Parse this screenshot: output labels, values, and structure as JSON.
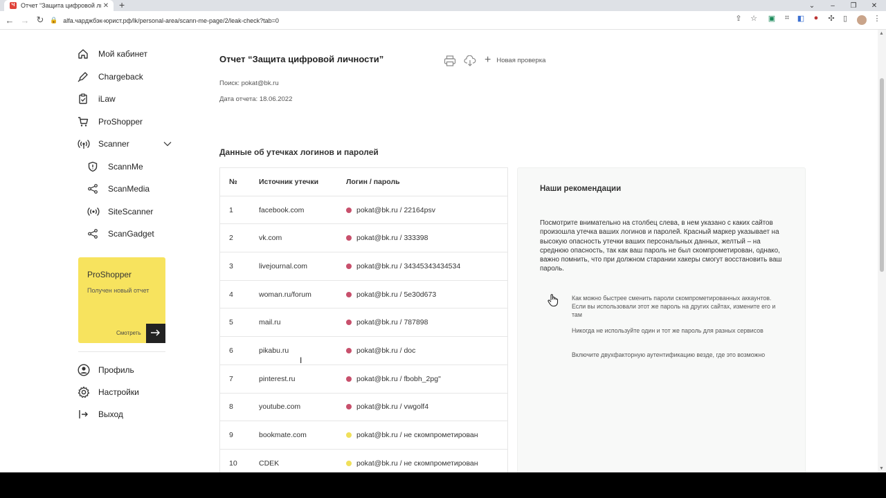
{
  "browser": {
    "tab_title": "Отчет “Защита цифровой личн",
    "tab_favicon": "Ч",
    "new_tab": "+",
    "url": "alfa.чарджбэк-юрист.рф/lk/personal-area/scann-me-page/2/leak-check?tab=0"
  },
  "sidebar": {
    "items": [
      {
        "label": "Мой кабинет",
        "icon": "home-icon"
      },
      {
        "label": "Chargeback",
        "icon": "pen-icon"
      },
      {
        "label": "iLaw",
        "icon": "clipboard-icon"
      },
      {
        "label": "ProShopper",
        "icon": "cart-icon"
      },
      {
        "label": "Scanner",
        "icon": "broadcast-icon"
      }
    ],
    "subitems": [
      {
        "label": "ScannMe",
        "icon": "shield-icon"
      },
      {
        "label": "ScanMedia",
        "icon": "share-icon"
      },
      {
        "label": "SiteScanner",
        "icon": "broadcast-icon"
      },
      {
        "label": "ScanGadget",
        "icon": "share-icon"
      }
    ],
    "promo": {
      "title": "ProShopper",
      "text": "Получен новый отчет",
      "link": "Смотреть"
    },
    "bottom": [
      {
        "label": "Профиль",
        "icon": "user-icon"
      },
      {
        "label": "Настройки",
        "icon": "gear-icon"
      },
      {
        "label": "Выход",
        "icon": "logout-icon"
      }
    ]
  },
  "report": {
    "title": "Отчет “Защита цифровой личности”",
    "new_check": "Новая проверка",
    "search": "Поиск: pokat@bk.ru",
    "date": "Дата отчета: 18.06.2022",
    "section_title": "Данные об утечках логинов и паролей"
  },
  "table": {
    "headers": [
      "№",
      "Источник утечки",
      "Логин / пароль"
    ],
    "rows": [
      {
        "num": "1",
        "source": "facebook.com",
        "cred": "pokat@bk.ru / 22164psv",
        "risk": "high"
      },
      {
        "num": "2",
        "source": "vk.com",
        "cred": "pokat@bk.ru / 333398",
        "risk": "high"
      },
      {
        "num": "3",
        "source": "livejournal.com",
        "cred": "pokat@bk.ru / 34345343434534",
        "risk": "high"
      },
      {
        "num": "4",
        "source": "woman.ru/forum",
        "cred": "pokat@bk.ru / 5e30d673",
        "risk": "high"
      },
      {
        "num": "5",
        "source": "mail.ru",
        "cred": "pokat@bk.ru / 787898",
        "risk": "high"
      },
      {
        "num": "6",
        "source": "pikabu.ru",
        "cred": "pokat@bk.ru / doc",
        "risk": "high"
      },
      {
        "num": "7",
        "source": "pinterest.ru",
        "cred": "pokat@bk.ru / fbobh_2pg\"",
        "risk": "high"
      },
      {
        "num": "8",
        "source": "youtube.com",
        "cred": "pokat@bk.ru / vwgolf4",
        "risk": "high"
      },
      {
        "num": "9",
        "source": "bookmate.com",
        "cred": "pokat@bk.ru / не скомпрометирован",
        "risk": "medium"
      },
      {
        "num": "10",
        "source": "CDEK",
        "cred": "pokat@bk.ru / не скомпрометирован",
        "risk": "medium"
      }
    ]
  },
  "recommendations": {
    "title": "Наши рекомендации",
    "body": "Посмотрите внимательно на столбец слева, в нем указано с каких сайтов произошла утечка ваших логинов и паролей. Красный маркер указывает на высокую опасность утечки ваших персональных данных, желтый – на среднюю опасность, так как ваш пароль не был скомпрометирован, однако, важно помнить, что при должном старании хакеры смогут восстановить ваш пароль.",
    "tips": [
      "Как можно быстрее сменить пароли скомпрометированных аккаунтов. Если вы использовали этот же пароль на других сайтах, измените его и там",
      "Никогда не используйте один и тот же пароль для разных сервисов",
      "Включите двухфакторную аутентификацию везде, где это возможно"
    ]
  },
  "colors": {
    "risk_high": "#c8506c",
    "risk_medium": "#f0e05a",
    "promo_bg": "#f7e35e"
  }
}
